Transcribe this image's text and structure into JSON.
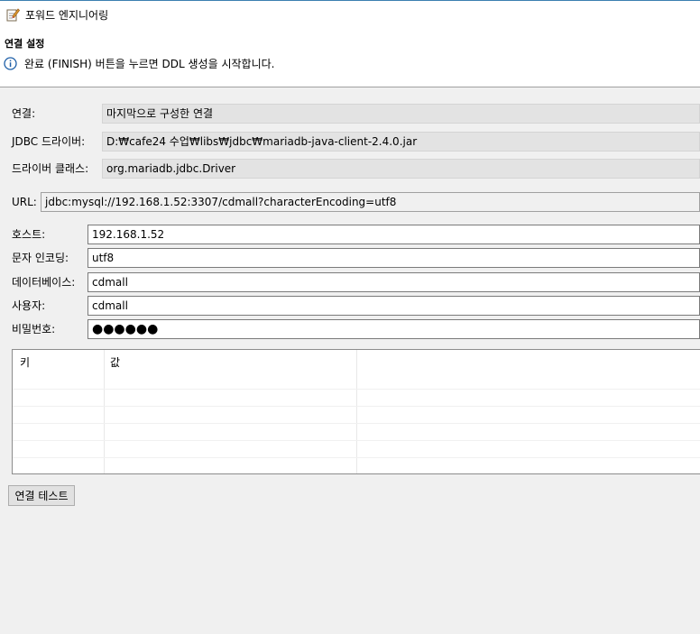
{
  "dialog": {
    "title": "포워드 엔지니어링",
    "icon": "edit-document-icon"
  },
  "header": {
    "section_title": "연결 설정",
    "message": "완료 (FINISH) 버튼을 누르면 DDL 생성을 시작합니다.",
    "message_icon": "info-icon"
  },
  "connection": {
    "label": "연결:",
    "value": "마지막으로 구성한 연결"
  },
  "jdbc_driver": {
    "label": "JDBC 드라이버:",
    "value": "D:₩cafe24 수업₩libs₩jdbc₩mariadb-java-client-2.4.0.jar"
  },
  "driver_class": {
    "label": "드라이버 클래스:",
    "value": "org.mariadb.jdbc.Driver"
  },
  "url": {
    "label": "URL:",
    "value": "jdbc:mysql://192.168.1.52:3307/cdmall?characterEncoding=utf8"
  },
  "host": {
    "label": "호스트:",
    "value": "192.168.1.52"
  },
  "encoding": {
    "label": "문자 인코딩:",
    "value": "utf8"
  },
  "database": {
    "label": "데이터베이스:",
    "value": "cdmall"
  },
  "user": {
    "label": "사용자:",
    "value": "cdmall"
  },
  "password": {
    "label": "비밀번호:",
    "value": "●●●●●●"
  },
  "properties_table": {
    "columns": [
      "키",
      "값"
    ],
    "rows": []
  },
  "test_button": {
    "label": "연결 테스트"
  },
  "colors": {
    "window_bg": "#f0f0f0",
    "header_bg": "#ffffff",
    "readonly_bg": "#e3e3e3",
    "accent": "#3c7fb1"
  }
}
